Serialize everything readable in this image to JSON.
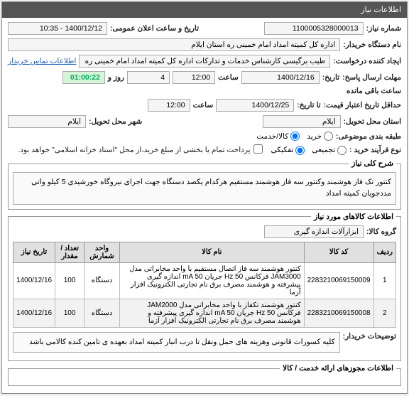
{
  "header": {
    "title": "اطلاعات نیاز"
  },
  "info": {
    "req_no_label": "شماره نیاز:",
    "req_no": "1100005328000013",
    "pub_label": "تاریخ و ساعت اعلان عمومی:",
    "pub_value": "1400/12/12 - 10:35",
    "buyer_label": "نام دستگاه خریدار:",
    "buyer_value": "اداره کل کمیته امداد امام خمینی  ره  استان ایلام",
    "creator_label": "ایجاد کننده درخواست:",
    "creator_value": "طیب برگیسی کارشناس خدمات و تدارکات اداره کل کمیته امداد امام خمینی  ره",
    "contact_link": "اطلاعات تماس خریدار",
    "deadline_label": "مهلت ارسال پاسخ:",
    "deadline_tarikh_label": "تاریخ:",
    "deadline_date": "1400/12/16",
    "deadline_time_label": "ساعت",
    "deadline_time": "12:00",
    "remain_days": "4",
    "remain_days_label": "روز و",
    "remain_time": "01:00:22",
    "remain_label": "ساعت باقی مانده",
    "min_valid_label": "حداقل تاریخ اعتبار قیمت:",
    "min_valid_tarikh_label": "تا تاریخ:",
    "min_valid_date": "1400/12/25",
    "min_valid_time_label": "ساعت",
    "min_valid_time": "12:00",
    "delivery_prov_label": "استان محل تحویل:",
    "delivery_prov": "ایلام",
    "delivery_city_label": "شهر محل تحویل:",
    "delivery_city": "ایلام",
    "class_label": "طبقه بندی موضوعی:",
    "class_opts": [
      "خرید",
      "کالا/خدمت"
    ],
    "buy_type_label": "نوع فرآیند خرید :",
    "buy_type_opts": [
      "تجمیعی",
      "تفکیکی"
    ],
    "pay_note": "پرداخت تمام یا بخشی از مبلغ خرید،از محل \"اسناد خزانه اسلامی\" خواهد بود."
  },
  "desc": {
    "legend": "شرح کلی نیاز",
    "text": "کنتور تک فاز هوشمند وکنتور سه فاز هوشمند مستقیم هرکدام یکصد دستگاه جهت اجرای نیروگاه خورشیدی 5 کیلو واتی مددجویان کمیته امداد"
  },
  "goods": {
    "legend": "اطلاعات کالاهای مورد نیاز",
    "group_label": "گروه کالا:",
    "group_value": "ابزارآلات اندازه گیری",
    "cols": [
      "ردیف",
      "کد کالا",
      "نام کالا",
      "واحد شمارش",
      "تعداد / مقدار",
      "تاریخ نیاز"
    ],
    "rows": [
      {
        "idx": "1",
        "code": "2283210069150009",
        "name": "کنتور هوشمند سه فاز اتصال مستقیم با واحد مخابراتی مدل JAM3000 فرکانس Hz 50 جریان mA 50 اندازه گیری پیشرفته و هوشمند مصرف برق نام تجارتی الکترونیک افزار آزما",
        "unit": "دستگاه",
        "qty": "100",
        "date": "1400/12/16"
      },
      {
        "idx": "2",
        "code": "2283210069150008",
        "name": "کنتور هوشمند تکفاز با واحد مخابراتی مدل JAM2000 فرکانس Hz 50 جریان mA 50 اندازه گیری پیشرفته و هوشمند مصرف برق نام تجارتی الکترونیک افزار آزما",
        "unit": "دستگاه",
        "qty": "100",
        "date": "1400/12/16"
      }
    ],
    "buyer_notes_label": "توضیحات خریدار:",
    "buyer_notes": "کلیه کسورات قانونی وهزینه های حمل ونقل تا درب انبار کمیته امداد بعهده ی تامین کنده کالامی باشد"
  },
  "footer": {
    "legend": "اطلاعات مجوزهای ارائه خدمت / کالا"
  }
}
